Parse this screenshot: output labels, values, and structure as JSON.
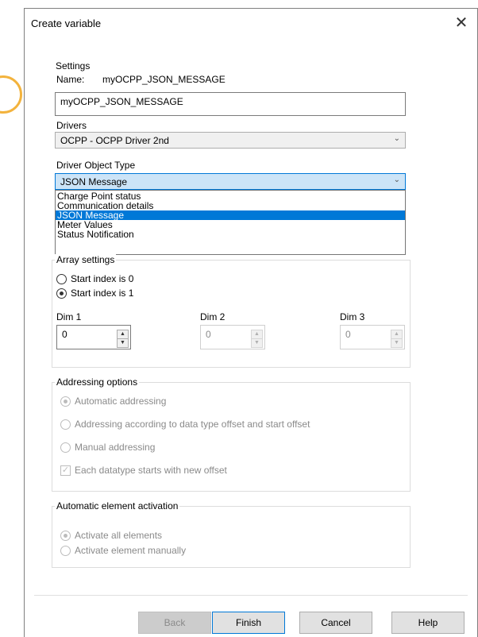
{
  "window": {
    "title": "Create variable",
    "close_symbol": "✕"
  },
  "settings": {
    "group_label": "Settings",
    "name_label": "Name:",
    "name_display": "myOCPP_JSON_MESSAGE",
    "name_value": "myOCPP_JSON_MESSAGE",
    "drivers_label": "Drivers",
    "drivers_value": "OCPP - OCPP Driver 2nd",
    "object_type_label": "Driver Object Type",
    "object_type_value": "JSON Message",
    "object_type_options": [
      "Charge Point status",
      "Communication details",
      "JSON Message",
      "Meter Values",
      "Status Notification"
    ],
    "object_type_selected_index": 2
  },
  "array_settings": {
    "group_label": "Array settings",
    "radio_0": "Start index is 0",
    "radio_1": "Start index is 1",
    "selected": 1,
    "dim1_label": "Dim 1",
    "dim1_value": "0",
    "dim2_label": "Dim 2",
    "dim2_value": "0",
    "dim3_label": "Dim 3",
    "dim3_value": "0"
  },
  "addressing": {
    "group_label": "Addressing options",
    "opt_auto": "Automatic addressing",
    "opt_offset": "Addressing according to data type offset and start offset",
    "opt_manual": "Manual addressing",
    "check_new_offset": "Each datatype starts with new offset"
  },
  "activation": {
    "group_label": "Automatic element activation",
    "opt_all": "Activate all elements",
    "opt_manual": "Activate element manually"
  },
  "buttons": {
    "back": "Back",
    "finish": "Finish",
    "cancel": "Cancel",
    "help": "Help"
  },
  "colors": {
    "accent": "#0078d7",
    "selection_bg": "#cce4f7",
    "decor_orange": "#f3b33d"
  }
}
